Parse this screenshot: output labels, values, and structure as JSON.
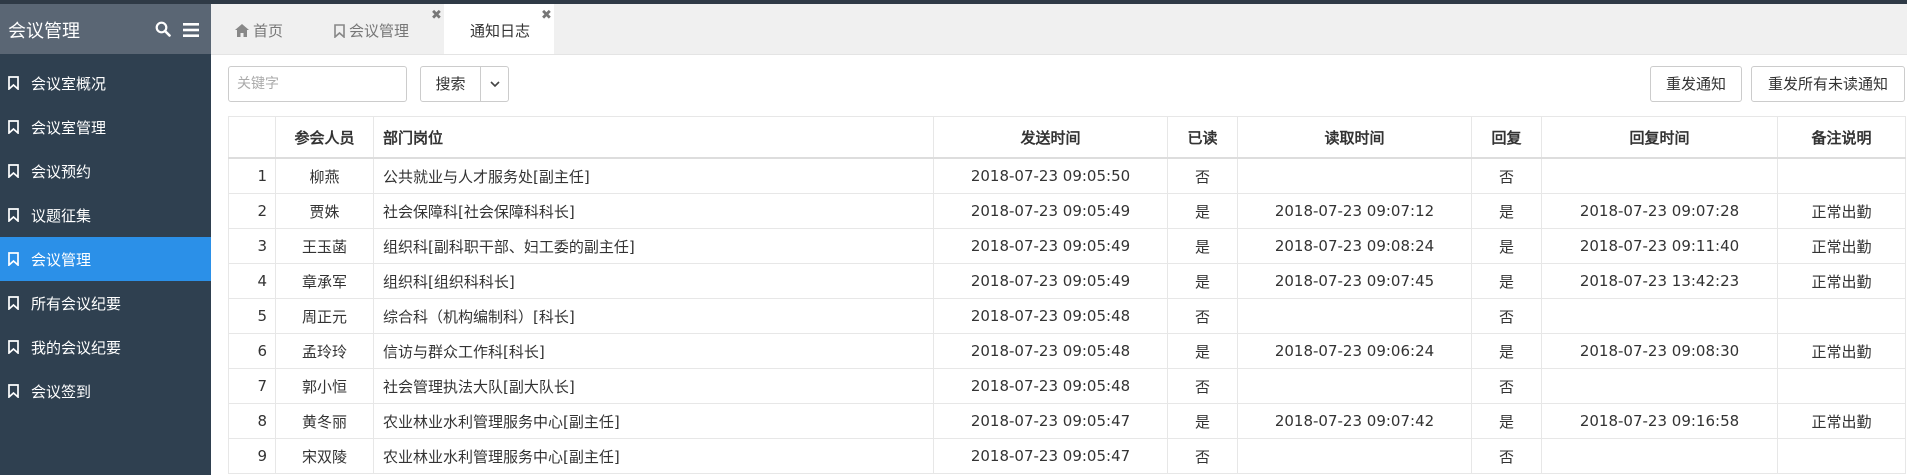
{
  "sidebar": {
    "title": "会议管理",
    "items": [
      {
        "label": "会议室概况",
        "active": false
      },
      {
        "label": "会议室管理",
        "active": false
      },
      {
        "label": "会议预约",
        "active": false
      },
      {
        "label": "议题征集",
        "active": false
      },
      {
        "label": "会议管理",
        "active": true
      },
      {
        "label": "所有会议纪要",
        "active": false
      },
      {
        "label": "我的会议纪要",
        "active": false
      },
      {
        "label": "会议签到",
        "active": false
      }
    ]
  },
  "tabs": [
    {
      "label": "首页",
      "icon": "home-icon",
      "closable": false,
      "active": false
    },
    {
      "label": "会议管理",
      "icon": "bookmark-icon",
      "closable": true,
      "active": false
    },
    {
      "label": "通知日志",
      "icon": "",
      "closable": true,
      "active": true
    }
  ],
  "toolbar": {
    "keyword_placeholder": "关键字",
    "search_label": "搜索",
    "resend_label": "重发通知",
    "resend_all_label": "重发所有未读通知"
  },
  "table": {
    "columns": [
      "",
      "参会人员",
      "部门岗位",
      "发送时间",
      "已读",
      "读取时间",
      "回复",
      "回复时间",
      "备注说明"
    ],
    "rows": [
      [
        "1",
        "柳燕",
        "公共就业与人才服务处[副主任]",
        "2018-07-23 09:05:50",
        "否",
        "",
        "否",
        "",
        ""
      ],
      [
        "2",
        "贾姝",
        "社会保障科[社会保障科科长]",
        "2018-07-23 09:05:49",
        "是",
        "2018-07-23 09:07:12",
        "是",
        "2018-07-23 09:07:28",
        "正常出勤"
      ],
      [
        "3",
        "王玉菡",
        "组织科[副科职干部、妇工委的副主任]",
        "2018-07-23 09:05:49",
        "是",
        "2018-07-23 09:08:24",
        "是",
        "2018-07-23 09:11:40",
        "正常出勤"
      ],
      [
        "4",
        "章承军",
        "组织科[组织科科长]",
        "2018-07-23 09:05:49",
        "是",
        "2018-07-23 09:07:45",
        "是",
        "2018-07-23 13:42:23",
        "正常出勤"
      ],
      [
        "5",
        "周正元",
        "综合科（机构编制科）[科长]",
        "2018-07-23 09:05:48",
        "否",
        "",
        "否",
        "",
        ""
      ],
      [
        "6",
        "孟玲玲",
        "信访与群众工作科[科长]",
        "2018-07-23 09:05:48",
        "是",
        "2018-07-23 09:06:24",
        "是",
        "2018-07-23 09:08:30",
        "正常出勤"
      ],
      [
        "7",
        "郭小恒",
        "社会管理执法大队[副大队长]",
        "2018-07-23 09:05:48",
        "否",
        "",
        "否",
        "",
        ""
      ],
      [
        "8",
        "黄冬丽",
        "农业林业水利管理服务中心[副主任]",
        "2018-07-23 09:05:47",
        "是",
        "2018-07-23 09:07:42",
        "是",
        "2018-07-23 09:16:58",
        "正常出勤"
      ],
      [
        "9",
        "宋双陵",
        "农业林业水利管理服务中心[副主任]",
        "2018-07-23 09:05:47",
        "否",
        "",
        "否",
        "",
        ""
      ]
    ]
  },
  "colors": {
    "sidebar_bg": "#2f4050",
    "sidebar_header_bg": "#5a6674",
    "sidebar_active_bg": "#2b90e8",
    "tabbar_bg": "#f0f0f0"
  }
}
